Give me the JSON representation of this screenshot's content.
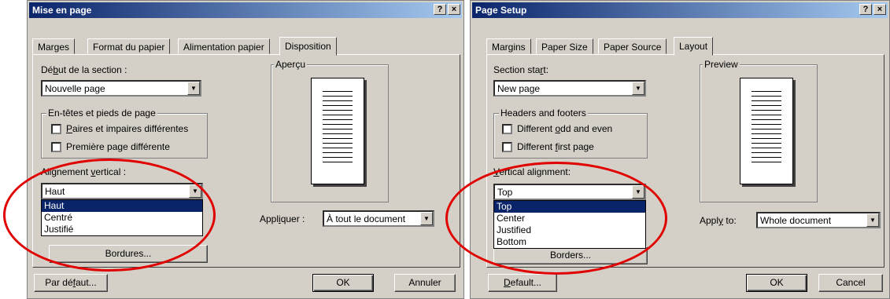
{
  "french": {
    "title": "Mise en page",
    "help_label": "?",
    "close_label": "×",
    "tabs": [
      "Marges",
      "Format du papier",
      "Alimentation papier",
      "Disposition"
    ],
    "section_start_label_pre": "Dé",
    "section_start_label_u": "b",
    "section_start_label_post": "ut de la section :",
    "section_start_value": "Nouvelle page",
    "headers_group": "En-têtes et pieds de page",
    "check1_u": "P",
    "check1_post": "aires et impaires différentes",
    "check2_pre": "Première pa",
    "check2_u": "g",
    "check2_post": "e différente",
    "valign_label_pre": "Alignement ",
    "valign_label_u": "v",
    "valign_label_post": "ertical :",
    "valign_value": "Haut",
    "valign_options": [
      "Haut",
      "Centré",
      "Justifié"
    ],
    "borders_label": "Bordures...",
    "preview_label": "Aperçu",
    "apply_label_pre": "Appl",
    "apply_label_u": "i",
    "apply_label_post": "quer :",
    "apply_value": "À tout le document",
    "default_label_pre": "Par dé",
    "default_label_u": "f",
    "default_label_post": "aut...",
    "ok_label": "OK",
    "cancel_label": "Annuler"
  },
  "english": {
    "title": "Page Setup",
    "help_label": "?",
    "close_label": "×",
    "tabs": [
      "Margins",
      "Paper Size",
      "Paper Source",
      "Layout"
    ],
    "section_start_label_pre": "Section sta",
    "section_start_label_u": "r",
    "section_start_label_post": "t:",
    "section_start_value": "New page",
    "headers_group": "Headers and footers",
    "check1_pre": "Different ",
    "check1_u": "o",
    "check1_post": "dd and even",
    "check2_pre": "Different ",
    "check2_u": "f",
    "check2_post": "irst page",
    "valign_label_pre": "",
    "valign_label_u": "V",
    "valign_label_post": "ertical alignment:",
    "valign_value": "Top",
    "valign_options": [
      "Top",
      "Center",
      "Justified",
      "Bottom"
    ],
    "borders_label": "Borders...",
    "preview_label": "Preview",
    "apply_label_pre": "Appl",
    "apply_label_u": "y",
    "apply_label_post": " to:",
    "apply_value": "Whole document",
    "default_label_u": "D",
    "default_label_post": "efault...",
    "ok_label": "OK",
    "cancel_label": "Cancel"
  },
  "colors": {
    "title_gradient_start": "#0a246a",
    "title_gradient_end": "#a6caf0",
    "dialog_face": "#d4d0c8",
    "highlight": "#0a246a",
    "annotation_ellipse": "#e00000"
  }
}
